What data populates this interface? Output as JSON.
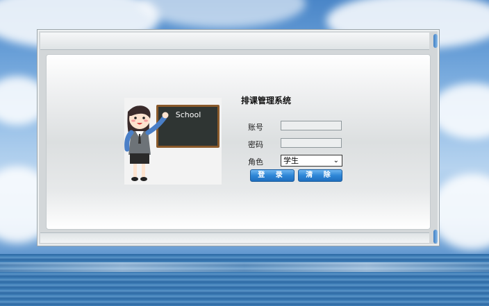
{
  "app": {
    "title": "排课管理系统"
  },
  "illustration": {
    "board_text": "School"
  },
  "form": {
    "account_label": "账号",
    "password_label": "密码",
    "role_label": "角色",
    "account_value": "",
    "password_value": "",
    "role_selected": "学生"
  },
  "buttons": {
    "login_label": "登 录",
    "clear_label": "清 除"
  },
  "colors": {
    "button_blue": "#2e86d6",
    "chalkboard": "#2f3533",
    "board_frame": "#8a5a2b"
  }
}
